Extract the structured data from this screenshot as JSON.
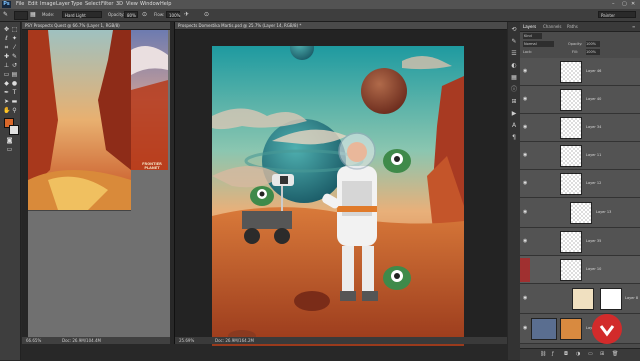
{
  "app": {
    "logo": "Ps"
  },
  "menu": [
    "File",
    "Edit",
    "Image",
    "Layer",
    "Type",
    "Select",
    "Filter",
    "3D",
    "View",
    "Window",
    "Help"
  ],
  "options_bar": {
    "mode_label": "Mode:",
    "mode_value": "Hard Light",
    "opacity_label": "Opacity:",
    "opacity_value": "80%",
    "flow_label": "Flow:",
    "flow_value": "100%",
    "workspace": "Painter"
  },
  "doc_small": {
    "title": "PSY Prospects Quest @ 66.7% (Layer 1, RGB/8)",
    "zoom": "66.65%",
    "status": "Doc: 26.9M/104.4M",
    "poster_text": "FRONTIER PLANET"
  },
  "doc_main": {
    "title": "Prospects Domestika Martis.psd @ 25.7% (Layer 14, RGB/8) *",
    "zoom": "25.69%",
    "status": "Doc: 26.9M/164.2M"
  },
  "layers_panel": {
    "tabs": [
      "Layers",
      "Channels",
      "Paths"
    ],
    "kind": "Kind",
    "blend_mode": "Normal",
    "opacity_label": "Opacity:",
    "opacity_value": "100%",
    "lock_label": "Lock:",
    "fill_label": "Fill:",
    "fill_value": "100%",
    "layers": [
      {
        "name": "Layer 46"
      },
      {
        "name": "Layer 40"
      },
      {
        "name": "Layer 34"
      },
      {
        "name": "Layer 11"
      },
      {
        "name": "Layer 12"
      },
      {
        "name": "Layer 13"
      },
      {
        "name": "Layer 35"
      },
      {
        "name": "Layer 10"
      },
      {
        "name": "Layer 8"
      },
      {
        "name": "Layer 1"
      }
    ]
  },
  "colors": {
    "accent": "#d22b2b",
    "foreground": "#d9682a",
    "background": "#e0e0e0"
  }
}
